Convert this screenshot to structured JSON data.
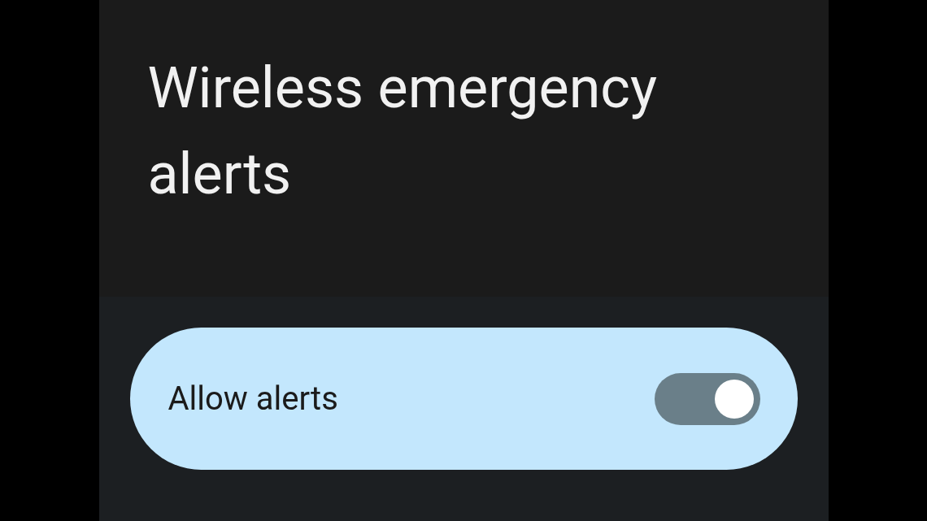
{
  "title": "Wireless emergency alerts",
  "toggle": {
    "label": "Allow alerts",
    "on": true
  }
}
